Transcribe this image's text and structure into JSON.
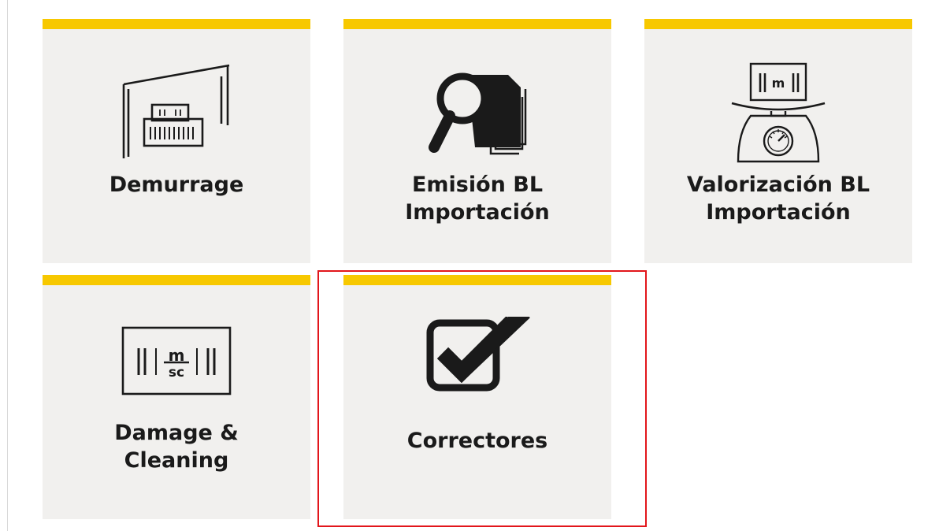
{
  "tiles": [
    {
      "id": "demurrage",
      "label": "Demurrage",
      "icon": "warehouse-container-icon"
    },
    {
      "id": "emision-bl",
      "label": "Emisión BL\nImportación",
      "icon": "magnifier-documents-icon"
    },
    {
      "id": "valorizacion-bl",
      "label": "Valorización BL\nImportación",
      "icon": "scale-container-icon"
    },
    {
      "id": "damage-cleaning",
      "label": "Damage &\nCleaning",
      "icon": "msc-container-icon"
    },
    {
      "id": "correctores",
      "label": "Correctores",
      "icon": "checkbox-icon"
    }
  ],
  "selected_tile": "correctores",
  "colors": {
    "tile_accent": "#f7c800",
    "tile_background": "#f1f0ee",
    "selection_border": "#e2161b",
    "text": "#1a1a1a"
  }
}
